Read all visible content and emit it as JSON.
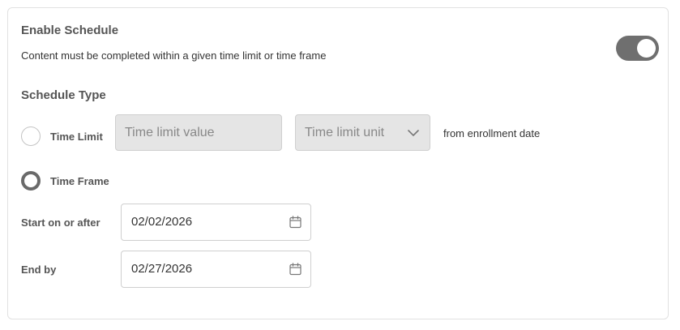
{
  "schedule": {
    "title": "Enable Schedule",
    "description": "Content must be completed within a given time limit or time frame",
    "enabled": true
  },
  "schedule_type": {
    "title": "Schedule Type",
    "time_limit": {
      "label": "Time Limit",
      "value_placeholder": "Time limit value",
      "unit_placeholder": "Time limit unit",
      "suffix": "from enrollment date",
      "selected": false
    },
    "time_frame": {
      "label": "Time Frame",
      "selected": true,
      "start_label": "Start on or after",
      "start_date": "02/02/2026",
      "end_label": "End by",
      "end_date": "02/27/2026"
    }
  },
  "colors": {
    "toggle_on": "#6f6f6f",
    "disabled_field": "#e5e5e5",
    "border": "#cfcfcf"
  },
  "icons": {
    "toggle": "toggle-switch-icon",
    "dropdown": "chevron-down-icon",
    "calendar": "calendar-icon"
  }
}
